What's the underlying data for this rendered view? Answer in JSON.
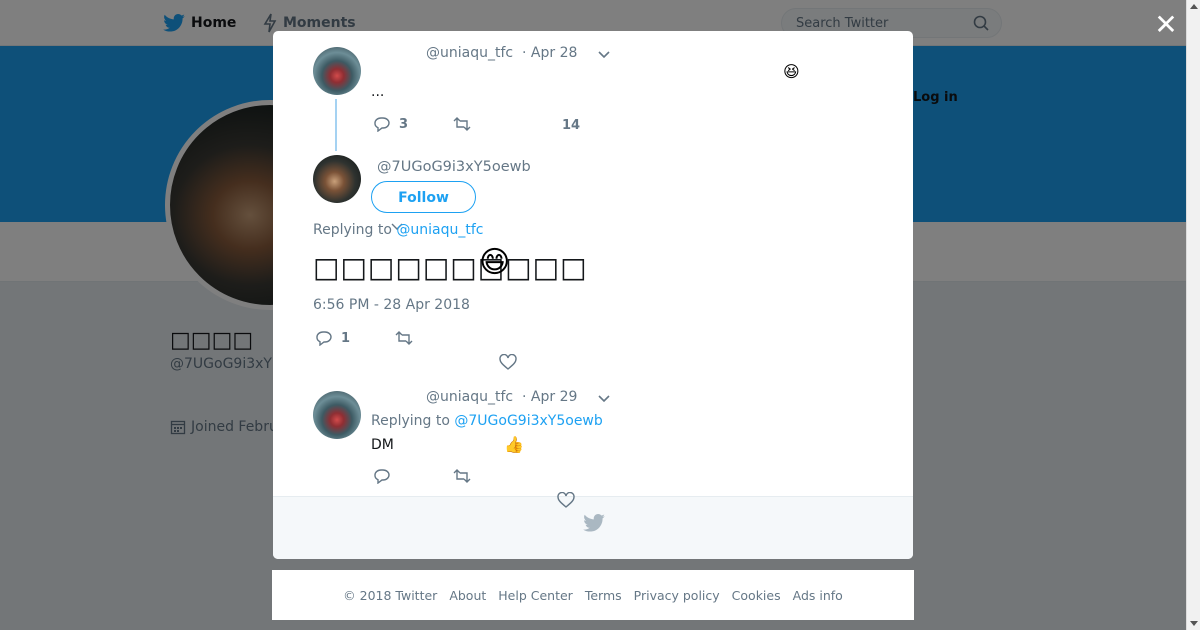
{
  "nav": {
    "home_label": "Home",
    "moments_label": "Moments",
    "search_placeholder": "Search Twitter",
    "login_label": "Log in"
  },
  "profile": {
    "name": "□□□□",
    "handle": "@7UGoG9i3xY",
    "joined": "Joined Febru"
  },
  "thread": {
    "tweet1": {
      "handle": "@uniaqu_tfc",
      "date": "· Apr 28",
      "text": "...",
      "reply_count": "3",
      "like_count": "14",
      "emoji": "😆"
    },
    "main_tweet": {
      "handle": "@7UGoG9i3xY5oewb",
      "follow_label": "Follow",
      "replying_prefix": "Replying to",
      "replying_to": "@uniaqu_tfc",
      "text": "□□□□□□□□□□",
      "emoji": "😄",
      "timestamp": "6:56 PM - 28 Apr 2018",
      "reply_count": "1"
    },
    "tweet3": {
      "handle": "@uniaqu_tfc",
      "date": "· Apr 29",
      "replying_prefix": "Replying to",
      "replying_to": "@7UGoG9i3xY5oewb",
      "text": "DM",
      "emoji": "👍"
    }
  },
  "footer": {
    "copyright": "© 2018 Twitter",
    "about": "About",
    "help": "Help Center",
    "terms": "Terms",
    "privacy": "Privacy policy",
    "cookies": "Cookies",
    "ads": "Ads info"
  },
  "colors": {
    "brand": "#1da1f2",
    "text": "#14171a",
    "muted": "#657786"
  },
  "icons": [
    "twitter-bird-icon",
    "lightning-icon",
    "search-icon",
    "close-icon",
    "reply-icon",
    "retweet-icon",
    "heart-icon",
    "chevron-down-icon",
    "calendar-icon"
  ]
}
